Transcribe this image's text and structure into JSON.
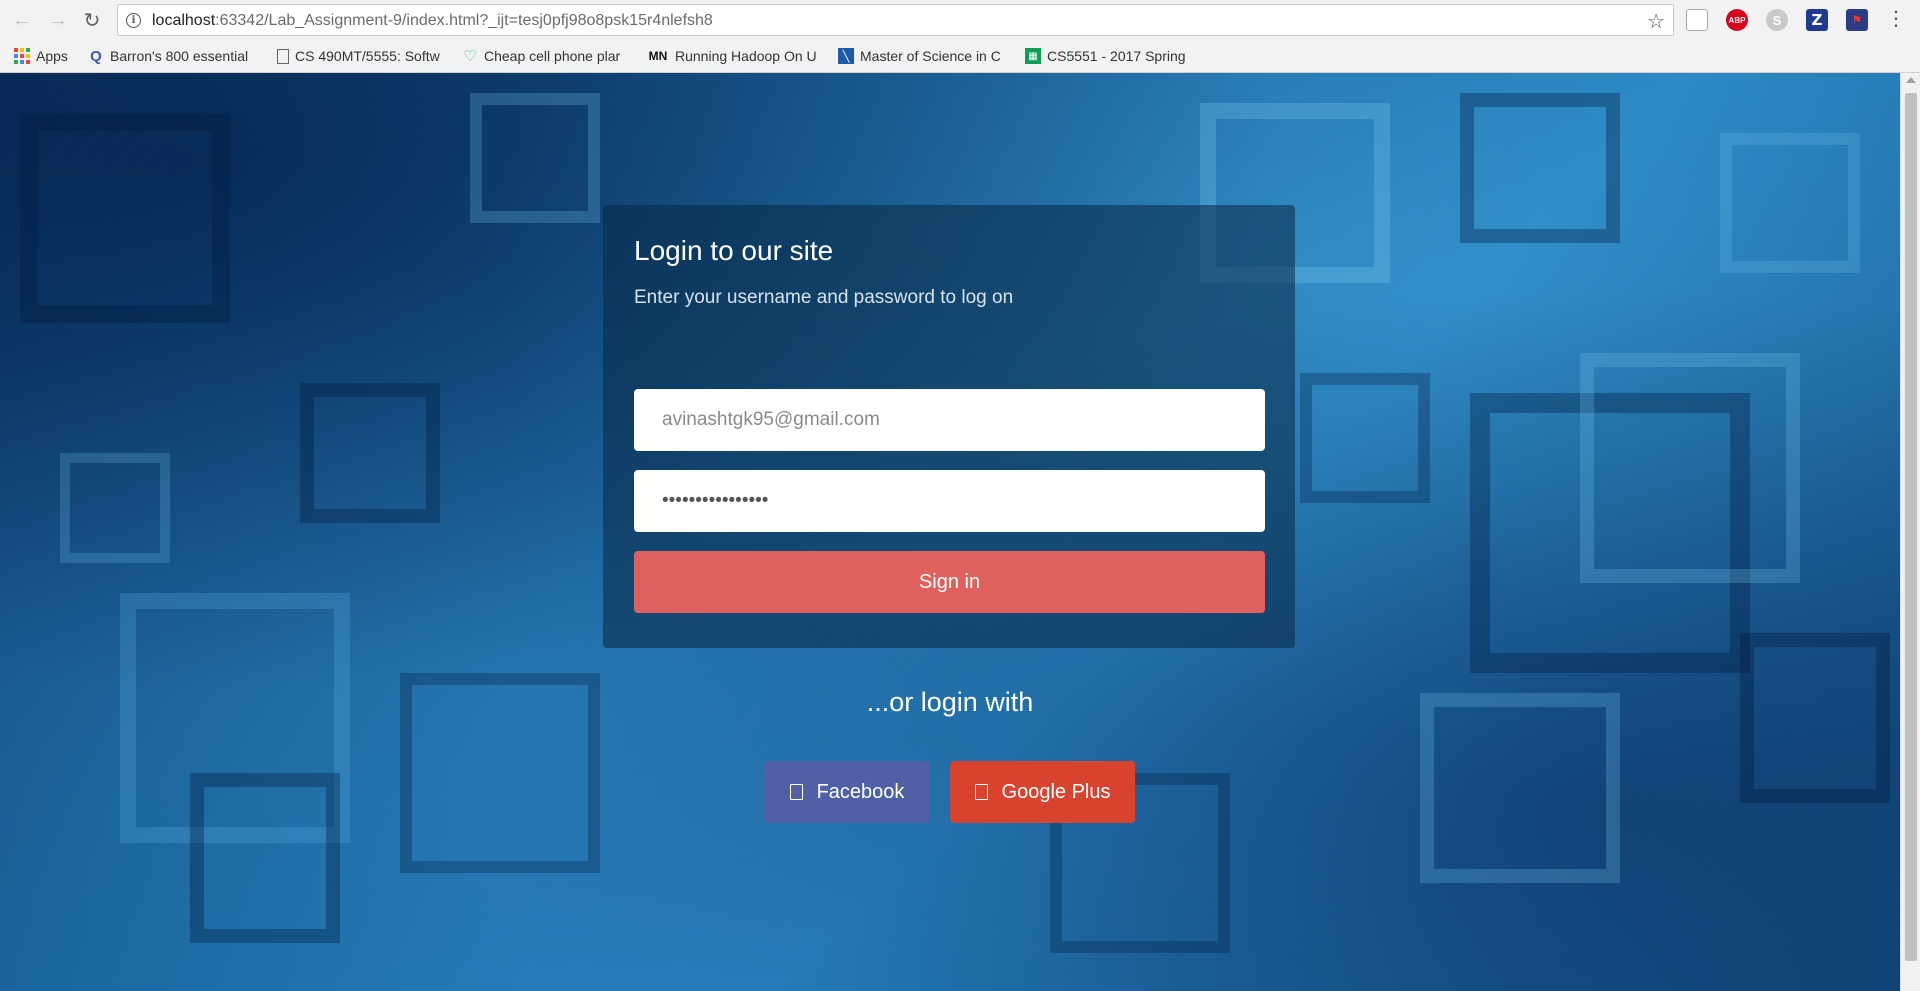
{
  "browser": {
    "url_host": "localhost",
    "url_rest": ":63342/Lab_Assignment-9/index.html?_ijt=tesj0pfj98o8psk15r4nlefsh8",
    "bookmarks": [
      {
        "label": "Apps",
        "icon": "apps-grid-icon"
      },
      {
        "label": "Barron's 800 essential",
        "icon": "quizlet-icon"
      },
      {
        "label": "CS 490MT/5555: Softw",
        "icon": "page-icon"
      },
      {
        "label": "Cheap cell phone plar",
        "icon": "heart-icon"
      },
      {
        "label": "Running Hadoop On U",
        "icon": "mn-icon"
      },
      {
        "label": "Master of Science in C",
        "icon": "umkc-icon"
      },
      {
        "label": "CS5551 - 2017 Spring",
        "icon": "sheets-icon"
      }
    ],
    "mn_text": "MN",
    "abp_text": "ABP",
    "zotero_text": "Z",
    "colors": {
      "chrome_bg": "#f2f2f2",
      "abp": "#d9001b",
      "zotero": "#1f3b8f"
    }
  },
  "login": {
    "title": "Login to our site",
    "subtitle": "Enter your username and password to log on",
    "email_value": "avinashtgk95@gmail.com",
    "password_mask": "••••••••••••••••",
    "signin_label": "Sign in"
  },
  "social": {
    "or_text": "...or login with",
    "facebook_label": "Facebook",
    "google_label": "Google Plus",
    "colors": {
      "facebook": "#4f60a6",
      "google": "#d8432f",
      "signin": "#de615e"
    }
  }
}
